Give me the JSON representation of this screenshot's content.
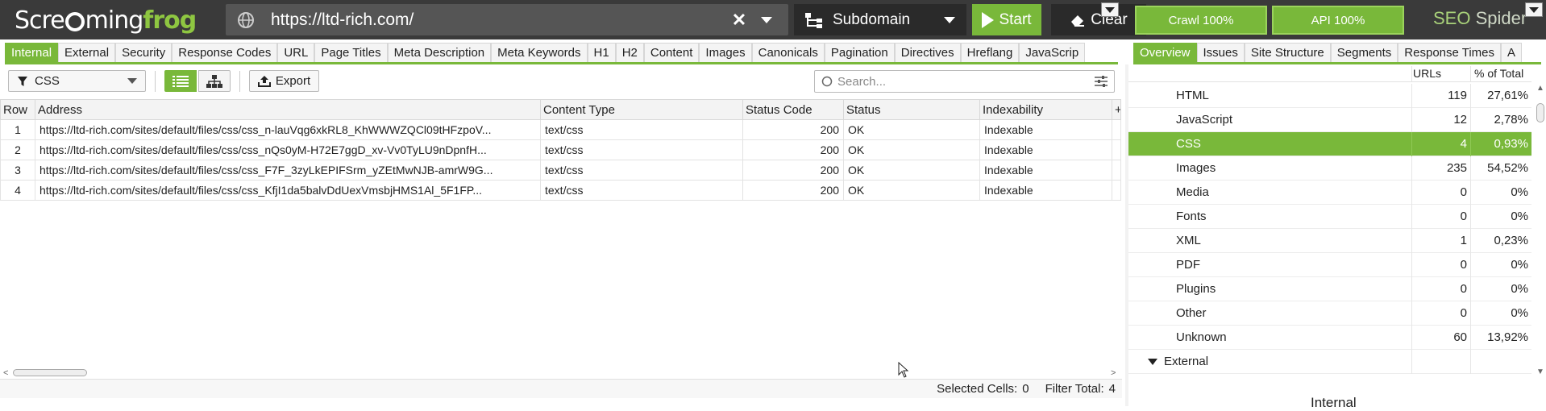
{
  "app": {
    "logo_prefix": "Scre",
    "logo_middle": "ming",
    "logo_frog": "frog",
    "brand_seo": "SEO",
    "brand_spider": "Spider"
  },
  "topbar": {
    "url": "https://ltd-rich.com/",
    "mode": "Subdomain",
    "start_label": "Start",
    "clear_label": "Clear",
    "crawl_meter": "Crawl 100%",
    "api_meter": "API 100%"
  },
  "left_tabs": [
    "Internal",
    "External",
    "Security",
    "Response Codes",
    "URL",
    "Page Titles",
    "Meta Description",
    "Meta Keywords",
    "H1",
    "H2",
    "Content",
    "Images",
    "Canonicals",
    "Pagination",
    "Directives",
    "Hreflang",
    "JavaScrip"
  ],
  "right_tabs": [
    "Overview",
    "Issues",
    "Site Structure",
    "Segments",
    "Response Times",
    "A"
  ],
  "toolbar": {
    "filter_value": "CSS",
    "export_label": "Export",
    "search_placeholder": "Search..."
  },
  "table": {
    "columns": [
      "Row",
      "Address",
      "Content Type",
      "Status Code",
      "Status",
      "Indexability",
      "+"
    ],
    "rows": [
      {
        "row": "1",
        "address": "https://ltd-rich.com/sites/default/files/css/css_n-lauVqg6xkRL8_KhWWWZQCl09tHFzpoV...",
        "content_type": "text/css",
        "status_code": "200",
        "status": "OK",
        "indexability": "Indexable"
      },
      {
        "row": "2",
        "address": "https://ltd-rich.com/sites/default/files/css/css_nQs0yM-H72E7ggD_xv-Vv0TyLU9nDpnfH...",
        "content_type": "text/css",
        "status_code": "200",
        "status": "OK",
        "indexability": "Indexable"
      },
      {
        "row": "3",
        "address": "https://ltd-rich.com/sites/default/files/css/css_F7F_3zyLkEPIFSrm_yZEtMwNJB-amrW9G...",
        "content_type": "text/css",
        "status_code": "200",
        "status": "OK",
        "indexability": "Indexable"
      },
      {
        "row": "4",
        "address": "https://ltd-rich.com/sites/default/files/css/css_KfjI1da5balvDdUexVmsbjHMS1Al_5F1FP...",
        "content_type": "text/css",
        "status_code": "200",
        "status": "OK",
        "indexability": "Indexable"
      }
    ]
  },
  "statusbar": {
    "selected_label": "Selected Cells:",
    "selected_value": "0",
    "filter_label": "Filter Total:",
    "filter_value": "4"
  },
  "overview": {
    "col_urls": "URLs",
    "col_pct": "% of Total",
    "rows": [
      {
        "name": "HTML",
        "urls": "119",
        "pct": "27,61%"
      },
      {
        "name": "JavaScript",
        "urls": "12",
        "pct": "2,78%"
      },
      {
        "name": "CSS",
        "urls": "4",
        "pct": "0,93%"
      },
      {
        "name": "Images",
        "urls": "235",
        "pct": "54,52%"
      },
      {
        "name": "Media",
        "urls": "0",
        "pct": "0%"
      },
      {
        "name": "Fonts",
        "urls": "0",
        "pct": "0%"
      },
      {
        "name": "XML",
        "urls": "1",
        "pct": "0,23%"
      },
      {
        "name": "PDF",
        "urls": "0",
        "pct": "0%"
      },
      {
        "name": "Plugins",
        "urls": "0",
        "pct": "0%"
      },
      {
        "name": "Other",
        "urls": "0",
        "pct": "0%"
      },
      {
        "name": "Unknown",
        "urls": "60",
        "pct": "13,92%"
      }
    ],
    "group_external": "External",
    "lower_title": "Internal"
  },
  "colors": {
    "accent": "#79b83a",
    "topbar_bg": "#3a3a3a"
  }
}
